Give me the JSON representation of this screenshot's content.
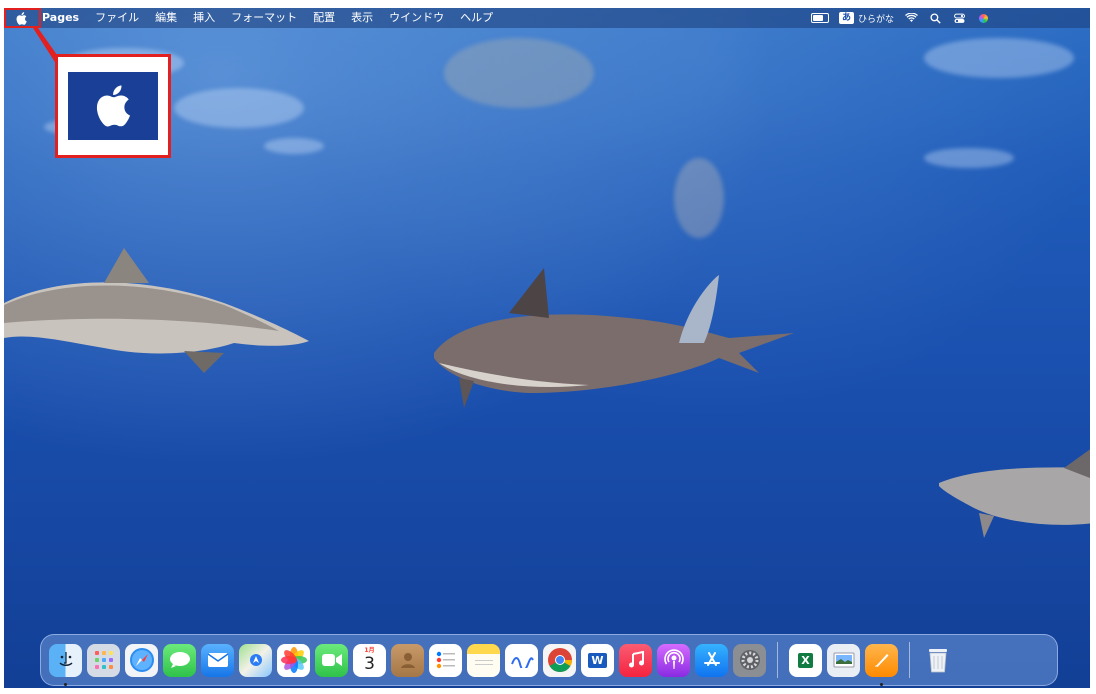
{
  "menubar": {
    "apple_icon": "apple-logo-icon",
    "app_name": "Pages",
    "items": [
      "ファイル",
      "編集",
      "挿入",
      "フォーマット",
      "配置",
      "表示",
      "ウインドウ",
      "ヘルプ"
    ],
    "status": {
      "input_source_badge": "あ",
      "input_source_label": "ひらがな",
      "icons": [
        "battery-icon",
        "wifi-icon",
        "search-icon",
        "control-center-icon",
        "siri-icon"
      ]
    }
  },
  "annotation": {
    "color": "#e32020",
    "zoomed_icon": "apple-logo-icon"
  },
  "dock": {
    "apps": [
      {
        "name": "Finder",
        "icon": "finder-icon",
        "running": true
      },
      {
        "name": "Launchpad",
        "icon": "launchpad-icon"
      },
      {
        "name": "Safari",
        "icon": "safari-icon"
      },
      {
        "name": "Messages",
        "icon": "messages-icon"
      },
      {
        "name": "Mail",
        "icon": "mail-icon"
      },
      {
        "name": "Maps",
        "icon": "maps-icon"
      },
      {
        "name": "Photos",
        "icon": "photos-icon"
      },
      {
        "name": "FaceTime",
        "icon": "facetime-icon"
      },
      {
        "name": "Calendar",
        "icon": "calendar-icon",
        "month": "1月",
        "day": "3"
      },
      {
        "name": "Contacts",
        "icon": "contacts-icon"
      },
      {
        "name": "Reminders",
        "icon": "reminders-icon"
      },
      {
        "name": "Notes",
        "icon": "notes-icon"
      },
      {
        "name": "Freeform",
        "icon": "freeform-icon"
      },
      {
        "name": "Chrome",
        "icon": "chrome-icon"
      },
      {
        "name": "Word",
        "icon": "word-icon",
        "letter": "W"
      },
      {
        "name": "Music",
        "icon": "music-icon"
      },
      {
        "name": "Podcasts",
        "icon": "podcasts-icon"
      },
      {
        "name": "App Store",
        "icon": "app-store-icon"
      },
      {
        "name": "System Settings",
        "icon": "system-settings-icon"
      }
    ],
    "recent_apps": [
      {
        "name": "Excel",
        "icon": "excel-icon",
        "letter": "X"
      },
      {
        "name": "Preview",
        "icon": "preview-icon"
      },
      {
        "name": "Pages",
        "icon": "pages-icon",
        "running": true
      }
    ],
    "trash": {
      "name": "Trash",
      "icon": "trash-icon"
    }
  }
}
